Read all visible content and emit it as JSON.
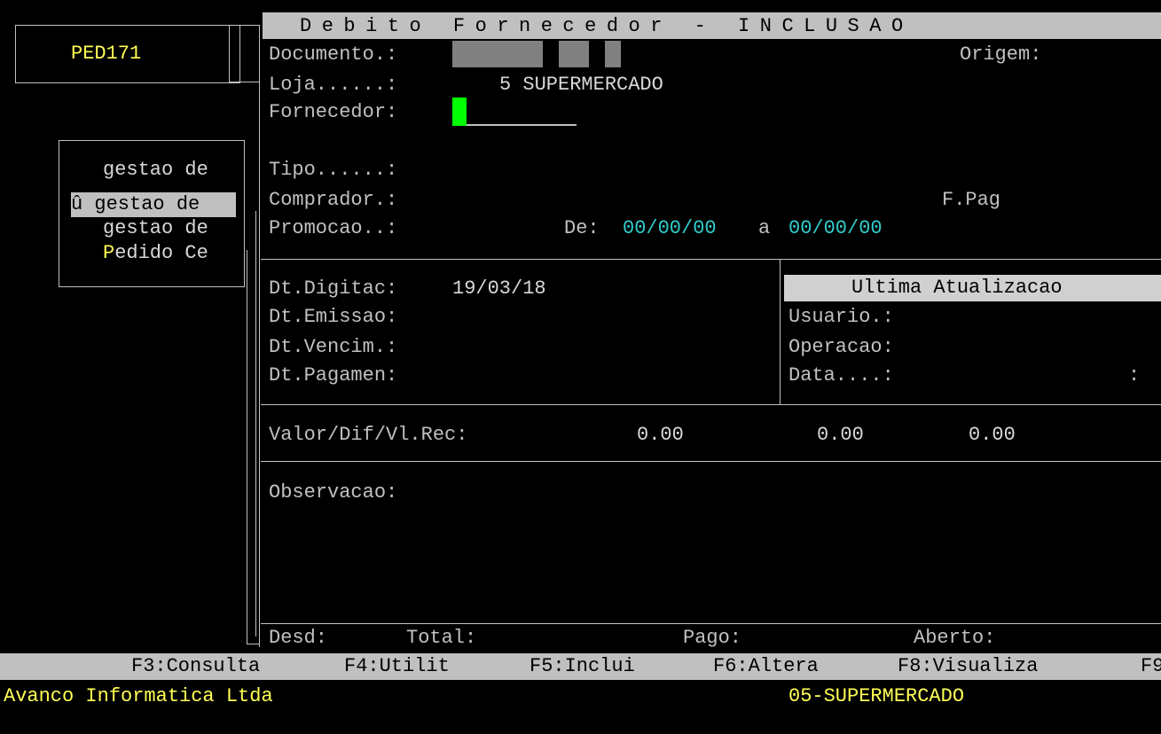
{
  "program": {
    "code": "PED171"
  },
  "menu": {
    "items": [
      {
        "label": "gestao de"
      },
      {
        "label": "û gestao de"
      },
      {
        "label": "gestao de"
      },
      {
        "label": "Pedido Ce",
        "hotkey": "P",
        "rest": "edido Ce"
      }
    ]
  },
  "form": {
    "title": "Debito Fornecedor - INCLUSAO",
    "documento_label": "Documento.:",
    "origem_label": "Origem:",
    "loja_label": "Loja......:",
    "loja_value": "5 SUPERMERCADO",
    "fornecedor_label": "Fornecedor:",
    "tipo_label": "Tipo......:",
    "comprador_label": "Comprador.:",
    "fpag_label": "F.Pag",
    "promocao_label": "Promocao..:",
    "de_label": "De:",
    "de_value": "00/00/00",
    "a_label": "a",
    "a_value": "00/00/00",
    "dt_digitac_label": "Dt.Digitac:",
    "dt_digitac_value": "19/03/18",
    "dt_emissao_label": "Dt.Emissao:",
    "dt_vencim_label": "Dt.Vencim.:",
    "dt_pagamen_label": "Dt.Pagamen:",
    "ultima_atualizacao_label": "Ultima Atualizacao",
    "usuario_label": "Usuario.:",
    "operacao_label": "Operacao:",
    "data_label": "Data....:",
    "data_sep": ":",
    "valor_label": "Valor/Dif/Vl.Rec:",
    "valor_1": "0.00",
    "valor_2": "0.00",
    "valor_3": "0.00",
    "observacao_label": "Observacao:",
    "desd_label": "Desd:",
    "total_label": "Total:",
    "pago_label": "Pago:",
    "aberto_label": "Aberto:"
  },
  "function_keys": [
    {
      "label": "F3:Consulta"
    },
    {
      "label": "F4:Utilit"
    },
    {
      "label": "F5:Inclui"
    },
    {
      "label": "F6:Altera"
    },
    {
      "label": "F8:Visualiza"
    },
    {
      "label": "F9"
    }
  ],
  "status": {
    "company": "Avanco Informatica Ltda",
    "store": "05-SUPERMERCADO"
  },
  "colors": {
    "background": "#000000",
    "text": "#c0c0c0",
    "highlight_yellow": "#ffff55",
    "date_cyan": "#33cccc",
    "cursor_green": "#00ff00",
    "bar_gray": "#c0c0c0"
  }
}
